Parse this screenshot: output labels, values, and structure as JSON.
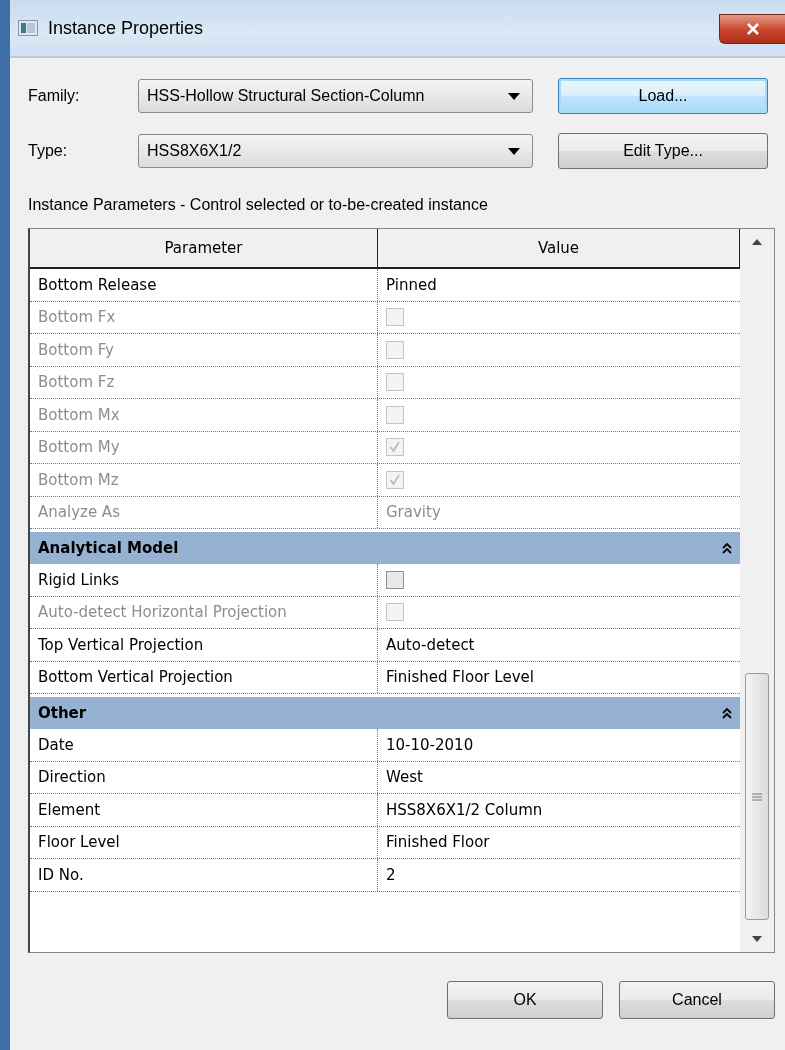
{
  "window": {
    "title": "Instance Properties"
  },
  "family": {
    "label": "Family:",
    "value": "HSS-Hollow Structural Section-Column"
  },
  "type": {
    "label": "Type:",
    "value": "HSS8X6X1/2"
  },
  "buttons_top": [
    {
      "label": "Load...",
      "focused": true
    },
    {
      "label": "Edit Type...",
      "focused": false
    }
  ],
  "section_label": "Instance Parameters - Control selected or to-be-created instance",
  "table": {
    "columns": [
      "Parameter",
      "Value"
    ],
    "rows": [
      {
        "kind": "text",
        "name": "Bottom Release",
        "value": "Pinned",
        "disabled": false
      },
      {
        "kind": "checkbox",
        "name": "Bottom Fx",
        "checked": false,
        "disabled": true
      },
      {
        "kind": "checkbox",
        "name": "Bottom Fy",
        "checked": false,
        "disabled": true
      },
      {
        "kind": "checkbox",
        "name": "Bottom Fz",
        "checked": false,
        "disabled": true
      },
      {
        "kind": "checkbox",
        "name": "Bottom Mx",
        "checked": false,
        "disabled": true
      },
      {
        "kind": "checkbox",
        "name": "Bottom My",
        "checked": true,
        "disabled": true
      },
      {
        "kind": "checkbox",
        "name": "Bottom Mz",
        "checked": true,
        "disabled": true
      },
      {
        "kind": "text",
        "name": "Analyze As",
        "value": "Gravity",
        "disabled": true
      },
      {
        "kind": "group",
        "name": "Analytical Model",
        "expanded": true
      },
      {
        "kind": "checkbox",
        "name": "Rigid Links",
        "checked": false,
        "disabled": false
      },
      {
        "kind": "checkbox",
        "name": "Auto-detect Horizontal Projection",
        "checked": false,
        "disabled": true
      },
      {
        "kind": "text",
        "name": "Top Vertical Projection",
        "value": "Auto-detect",
        "disabled": false
      },
      {
        "kind": "text",
        "name": "Bottom Vertical Projection",
        "value": "Finished Floor Level",
        "disabled": false
      },
      {
        "kind": "group",
        "name": "Other",
        "expanded": true
      },
      {
        "kind": "text",
        "name": "Date",
        "value": "10-10-2010",
        "disabled": false
      },
      {
        "kind": "text",
        "name": "Direction",
        "value": "West",
        "disabled": false
      },
      {
        "kind": "text",
        "name": "Element",
        "value": "HSS8X6X1/2 Column",
        "disabled": false
      },
      {
        "kind": "text",
        "name": "Floor Level",
        "value": "Finished Floor",
        "disabled": false
      },
      {
        "kind": "text",
        "name": "ID No.",
        "value": "2",
        "disabled": false
      }
    ]
  },
  "buttons": [
    "OK",
    "Cancel"
  ]
}
